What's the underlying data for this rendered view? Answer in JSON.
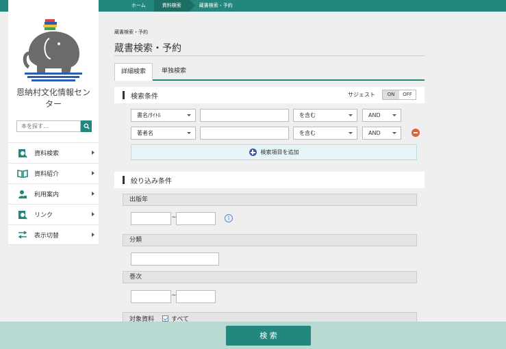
{
  "breadcrumb": [
    "ホーム",
    "資料検索",
    "蔵書検索・予約"
  ],
  "sidebar": {
    "org_name": "恩納村文化情報センター",
    "search_placeholder": "本を探す…",
    "items": [
      {
        "label": "資料検索",
        "icon": "book-search-icon"
      },
      {
        "label": "資料紹介",
        "icon": "open-book-icon"
      },
      {
        "label": "利用案内",
        "icon": "person-icon"
      },
      {
        "label": "リンク",
        "icon": "link-search-icon"
      },
      {
        "label": "表示切替",
        "icon": "swap-arrows-icon"
      }
    ]
  },
  "main": {
    "subtitle": "蔵書検索・予約",
    "title": "蔵書検索・予約",
    "tabs": [
      "詳細検索",
      "単独検索"
    ],
    "conditions": {
      "heading": "検索条件",
      "suggest_label": "サジェスト",
      "toggle_on": "ON",
      "toggle_off": "OFF",
      "rows": [
        {
          "field": "書名/ﾀｲﾄﾙ",
          "value": "",
          "match": "を含む",
          "op": "AND"
        },
        {
          "field": "著者名",
          "value": "",
          "match": "を含む",
          "op": "AND"
        }
      ],
      "add_label": "検索項目を追加"
    },
    "filters": {
      "heading": "絞り込み条件",
      "year_label": "出版年",
      "range_sep": "~",
      "class_label": "分類",
      "volume_label": "巻次",
      "target_label": "対象資料",
      "target_all": "すべて"
    },
    "submit": "検 索"
  },
  "colors": {
    "accent": "#23877d",
    "bottom_bar": "#b8d9d2",
    "remove": "#e0603a"
  }
}
